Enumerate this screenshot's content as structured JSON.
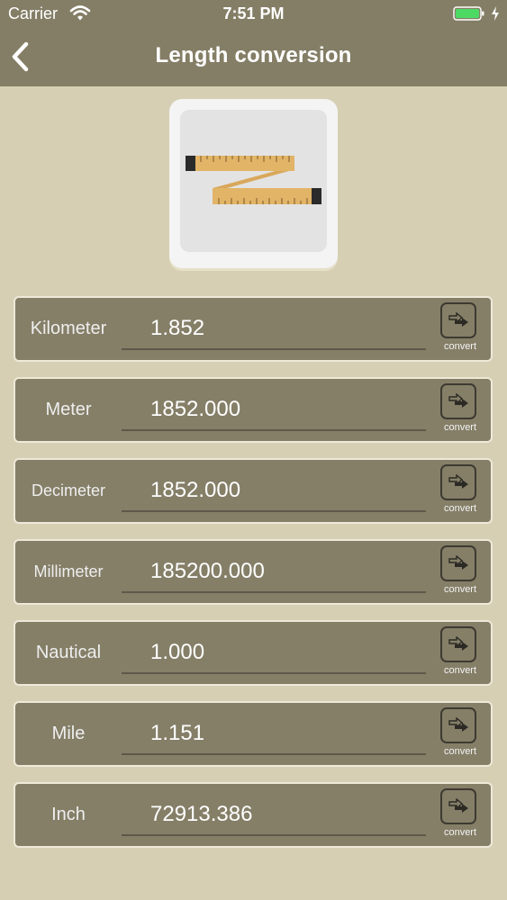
{
  "status_bar": {
    "carrier": "Carrier",
    "time": "7:51 PM",
    "battery_color": "#4cd964"
  },
  "nav": {
    "back_icon": "chevron-left-icon",
    "title": "Length conversion"
  },
  "app_icon": {
    "icon": "folding-ruler-icon",
    "ruler_color": "#e2b467"
  },
  "conversions": [
    {
      "label": "Kilometer",
      "value": "1.852",
      "button": "convert"
    },
    {
      "label": "Meter",
      "value": "1852.000",
      "button": "convert"
    },
    {
      "label": "Decimeter",
      "value": "1852.000",
      "button": "convert"
    },
    {
      "label": "Millimeter",
      "value": "185200.000",
      "button": "convert"
    },
    {
      "label": "Nautical",
      "value": "1.000",
      "button": "convert"
    },
    {
      "label": "Mile",
      "value": "1.151",
      "button": "convert"
    },
    {
      "label": "Inch",
      "value": "72913.386",
      "button": "convert"
    }
  ],
  "colors": {
    "header": "#847e66",
    "background": "#d6cfb4",
    "row": "#857f68"
  }
}
